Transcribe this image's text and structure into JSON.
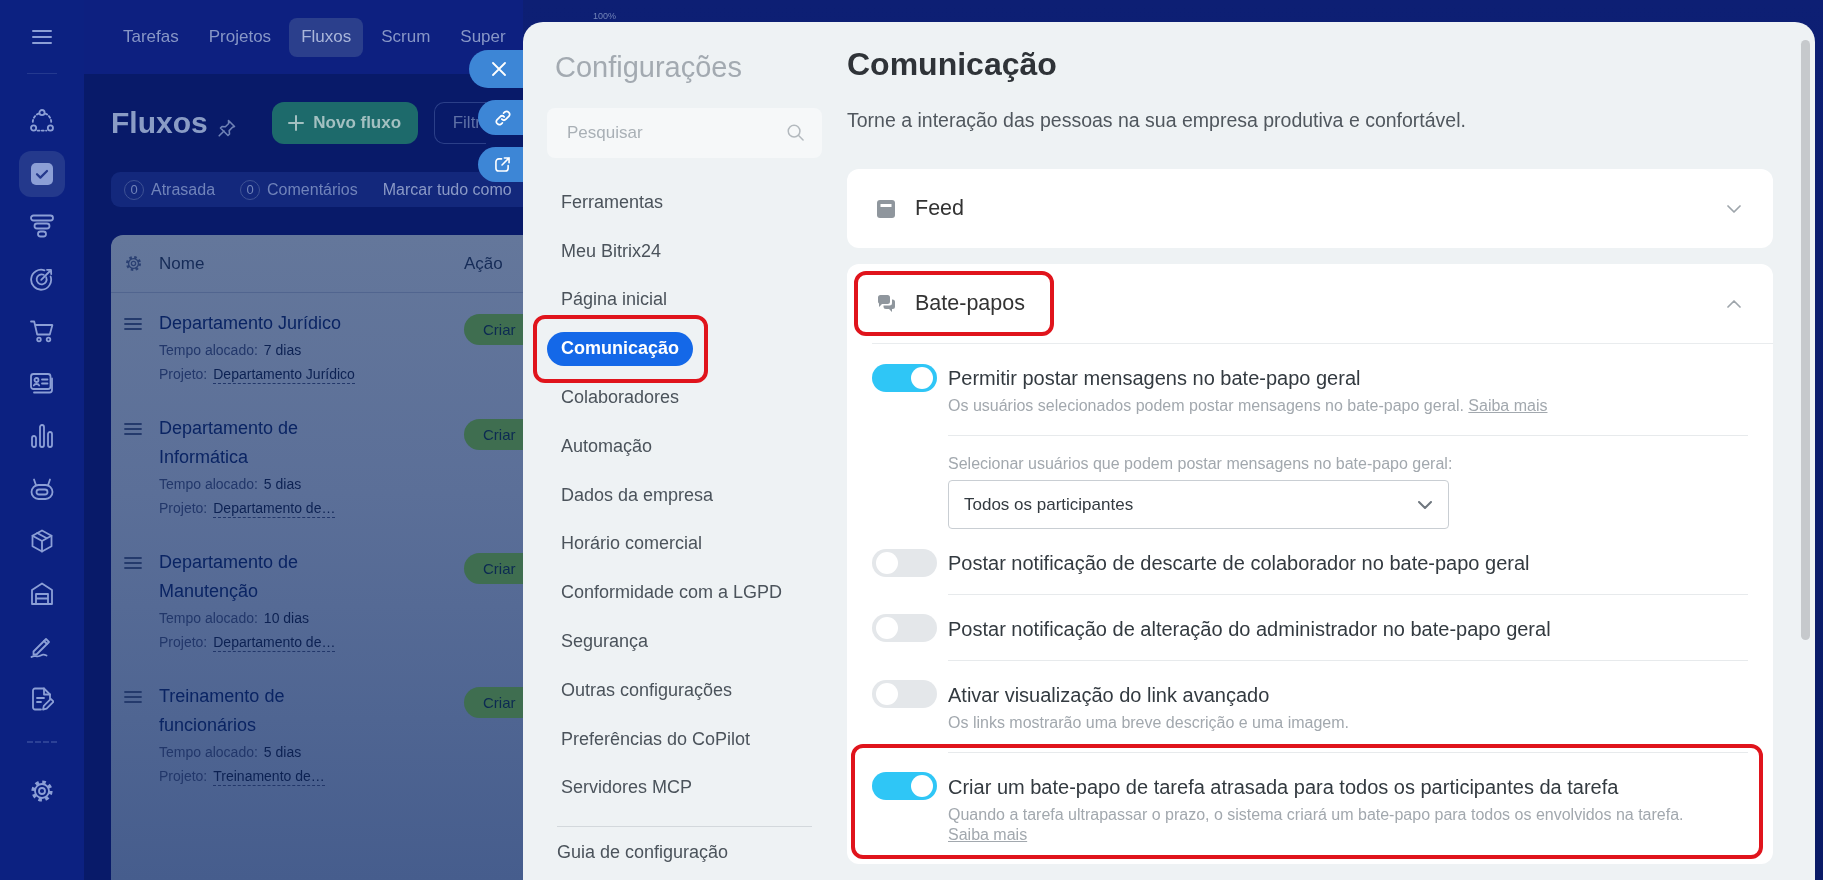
{
  "app": {
    "nav": [
      {
        "selected": false
      },
      {
        "selected": true
      },
      {
        "selected": false
      },
      {
        "selected": false
      },
      {
        "selected": false
      },
      {
        "selected": false
      },
      {
        "selected": false
      },
      {
        "selected": false
      },
      {
        "selected": false
      },
      {
        "selected": false
      },
      {
        "selected": false
      },
      {
        "selected": false
      },
      {
        "selected": false
      }
    ],
    "tabs": [
      {
        "label": "Tarefas",
        "selected": false
      },
      {
        "label": "Projetos",
        "selected": false
      },
      {
        "label": "Fluxos",
        "selected": true
      },
      {
        "label": "Scrum",
        "selected": false
      },
      {
        "label": "Super",
        "selected": false
      }
    ],
    "title": "Fluxos",
    "new_button": "Novo fluxo",
    "filter": {
      "placeholder": "Filtr"
    },
    "counters": [
      {
        "count": "0",
        "label": "Atrasada"
      },
      {
        "count": "0",
        "label": "Comentários"
      }
    ],
    "mark_all": "Marcar tudo como",
    "table": {
      "columns": [
        "Nome",
        "Ação"
      ],
      "rows": [
        {
          "name": "Departamento Jurídico",
          "time_label": "Tempo alocado:",
          "time": "7 dias",
          "project_label": "Projeto:",
          "project": "Departamento Jurídico",
          "action": "Criar"
        },
        {
          "name": "Departamento de Informática",
          "time_label": "Tempo alocado:",
          "time": "5 dias",
          "project_label": "Projeto:",
          "project": "Departamento de…",
          "action": "Criar"
        },
        {
          "name": "Departamento de Manutenção",
          "time_label": "Tempo alocado:",
          "time": "10 dias",
          "project_label": "Projeto:",
          "project": "Departamento de…",
          "action": "Criar"
        },
        {
          "name": "Treinamento de funcionários",
          "time_label": "Tempo alocado:",
          "time": "5 dias",
          "project_label": "Projeto:",
          "project": "Treinamento de…",
          "action": "Criar"
        }
      ]
    }
  },
  "zoom_level": "100%",
  "settings": {
    "title": "Configurações",
    "search": {
      "placeholder": "Pesquisar"
    },
    "menu": [
      {
        "label": "Ferramentas",
        "selected": false,
        "highlighted": false
      },
      {
        "label": "Meu Bitrix24",
        "selected": false,
        "highlighted": false
      },
      {
        "label": "Página inicial",
        "selected": false,
        "highlighted": false
      },
      {
        "label": "Comunicação",
        "selected": true,
        "highlighted": true
      },
      {
        "label": "Colaboradores",
        "selected": false,
        "highlighted": false
      },
      {
        "label": "Automação",
        "selected": false,
        "highlighted": false
      },
      {
        "label": "Dados da empresa",
        "selected": false,
        "highlighted": false
      },
      {
        "label": "Horário comercial",
        "selected": false,
        "highlighted": false
      },
      {
        "label": "Conformidade com a LGPD",
        "selected": false,
        "highlighted": false
      },
      {
        "label": "Segurança",
        "selected": false,
        "highlighted": false
      },
      {
        "label": "Outras configurações",
        "selected": false,
        "highlighted": false
      },
      {
        "label": "Preferências do CoPilot",
        "selected": false,
        "highlighted": false
      },
      {
        "label": "Servidores MCP",
        "selected": false,
        "highlighted": false
      }
    ],
    "guide_link": "Guia de configuração"
  },
  "content": {
    "title": "Comunicação",
    "subtitle": "Torne a interação das pessoas na sua empresa produtiva e confortável.",
    "sections": [
      {
        "title": "Feed",
        "expanded": false,
        "highlighted": false
      },
      {
        "title": "Bate-papos",
        "expanded": true,
        "highlighted": true,
        "settings": [
          {
            "kind": "toggle",
            "label": "Permitir postar mensagens no bate-papo geral",
            "on": true,
            "description": "Os usuários selecionados podem postar mensagens no bate-papo geral.",
            "link": "Saiba mais",
            "highlighted": false
          },
          {
            "kind": "select",
            "label": "Selecionar usuários que podem postar mensagens no bate-papo geral:",
            "value": "Todos os participantes",
            "highlighted": false
          },
          {
            "kind": "toggle",
            "label": "Postar notificação de descarte de colaborador no bate-papo geral",
            "on": false,
            "highlighted": false
          },
          {
            "kind": "toggle",
            "label": "Postar notificação de alteração do administrador no bate-papo geral",
            "on": false,
            "highlighted": false
          },
          {
            "kind": "toggle",
            "label": "Ativar visualização do link avançado",
            "on": false,
            "description": "Os links mostrarão uma breve descrição e uma imagem.",
            "highlighted": false
          },
          {
            "kind": "toggle",
            "label": "Criar um bate-papo de tarefa atrasada para todos os participantes da tarefa",
            "on": true,
            "description": "Quando a tarefa ultrapassar o prazo, o sistema criará um bate-papo para todos os envolvidos na tarefa.",
            "link": "Saiba mais",
            "highlighted": true
          }
        ]
      }
    ]
  }
}
